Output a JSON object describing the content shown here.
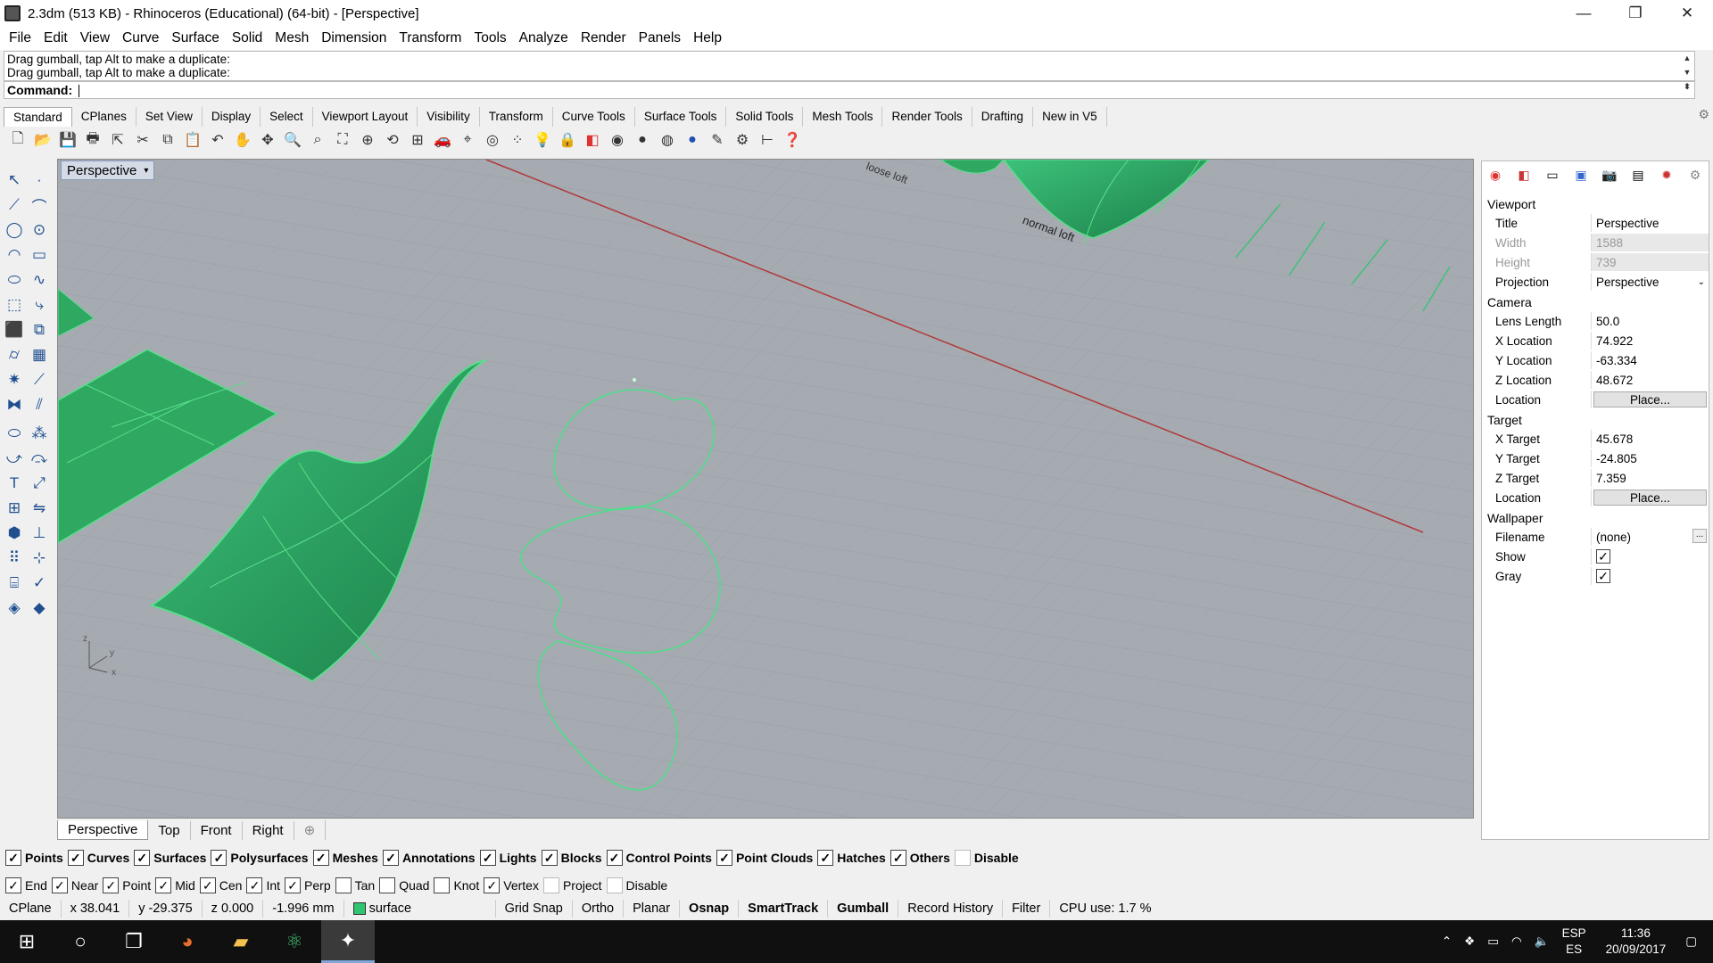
{
  "window": {
    "title": "2.3dm (513 KB) - Rhinoceros (Educational) (64-bit) - [Perspective]",
    "min": "—",
    "max": "❐",
    "close": "✕"
  },
  "menu": [
    "File",
    "Edit",
    "View",
    "Curve",
    "Surface",
    "Solid",
    "Mesh",
    "Dimension",
    "Transform",
    "Tools",
    "Analyze",
    "Render",
    "Panels",
    "Help"
  ],
  "command": {
    "history": [
      "Drag gumball, tap Alt to make a duplicate:",
      "Drag gumball, tap Alt to make a duplicate:"
    ],
    "prompt": "Command:"
  },
  "toolTabs": [
    "Standard",
    "CPlanes",
    "Set View",
    "Display",
    "Select",
    "Viewport Layout",
    "Visibility",
    "Transform",
    "Curve Tools",
    "Surface Tools",
    "Solid Tools",
    "Mesh Tools",
    "Render Tools",
    "Drafting",
    "New in V5"
  ],
  "viewport": {
    "name": "Perspective",
    "annotations": [
      "loose loft",
      "normal loft"
    ],
    "axes": [
      "z",
      "y",
      "x"
    ]
  },
  "viewportTabs": [
    "Perspective",
    "Top",
    "Front",
    "Right",
    "⊕"
  ],
  "properties": {
    "viewport_header": "Viewport",
    "viewport": [
      {
        "k": "Title",
        "v": "Perspective"
      },
      {
        "k": "Width",
        "v": "1588"
      },
      {
        "k": "Height",
        "v": "739"
      },
      {
        "k": "Projection",
        "v": "Perspective"
      }
    ],
    "camera_header": "Camera",
    "camera": [
      {
        "k": "Lens Length",
        "v": "50.0"
      },
      {
        "k": "X Location",
        "v": "74.922"
      },
      {
        "k": "Y Location",
        "v": "-63.334"
      },
      {
        "k": "Z Location",
        "v": "48.672"
      },
      {
        "k": "Location",
        "v": "Place..."
      }
    ],
    "target_header": "Target",
    "target": [
      {
        "k": "X Target",
        "v": "45.678"
      },
      {
        "k": "Y Target",
        "v": "-24.805"
      },
      {
        "k": "Z Target",
        "v": "7.359"
      },
      {
        "k": "Location",
        "v": "Place..."
      }
    ],
    "wallpaper_header": "Wallpaper",
    "wallpaper": [
      {
        "k": "Filename",
        "v": "(none)"
      },
      {
        "k": "Show",
        "v": ""
      },
      {
        "k": "Gray",
        "v": ""
      }
    ],
    "browse": "..."
  },
  "filters": [
    {
      "label": "Points",
      "on": true
    },
    {
      "label": "Curves",
      "on": true
    },
    {
      "label": "Surfaces",
      "on": true
    },
    {
      "label": "Polysurfaces",
      "on": true
    },
    {
      "label": "Meshes",
      "on": true
    },
    {
      "label": "Annotations",
      "on": true
    },
    {
      "label": "Lights",
      "on": true
    },
    {
      "label": "Blocks",
      "on": true
    },
    {
      "label": "Control Points",
      "on": true
    },
    {
      "label": "Point Clouds",
      "on": true
    },
    {
      "label": "Hatches",
      "on": true
    },
    {
      "label": "Others",
      "on": true
    },
    {
      "label": "Disable",
      "on": false
    }
  ],
  "osnaps": [
    {
      "label": "End",
      "on": true
    },
    {
      "label": "Near",
      "on": true
    },
    {
      "label": "Point",
      "on": true
    },
    {
      "label": "Mid",
      "on": true
    },
    {
      "label": "Cen",
      "on": true
    },
    {
      "label": "Int",
      "on": true
    },
    {
      "label": "Perp",
      "on": true
    },
    {
      "label": "Tan",
      "on": false
    },
    {
      "label": "Quad",
      "on": false
    },
    {
      "label": "Knot",
      "on": false
    },
    {
      "label": "Vertex",
      "on": true
    },
    {
      "label": "Project",
      "on": false
    },
    {
      "label": "Disable",
      "on": false
    }
  ],
  "status": {
    "cplane": "CPlane",
    "x": "x 38.041",
    "y": "y -29.375",
    "z": "z 0.000",
    "dist": "-1.996 mm",
    "layer": "surface",
    "gridsnap": "Grid Snap",
    "ortho": "Ortho",
    "planar": "Planar",
    "osnap": "Osnap",
    "smarttrack": "SmartTrack",
    "gumball": "Gumball",
    "record": "Record History",
    "filter": "Filter",
    "cpu": "CPU use: 1.7 %"
  },
  "taskbar": {
    "lang1": "ESP",
    "lang2": "ES",
    "time": "11:36",
    "date": "20/09/2017"
  },
  "colors": {
    "surface": "#2fa862",
    "edge": "#58e08a",
    "axis_x": "#b03a3a",
    "viewport_bg": "#a6aab1"
  }
}
